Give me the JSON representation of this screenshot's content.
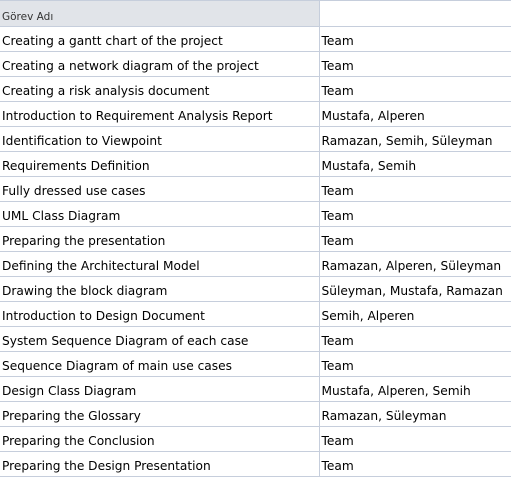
{
  "header": {
    "task_name": "Görev Adı",
    "resources": ""
  },
  "rows": [
    {
      "task": "Creating a gantt chart of the project",
      "resources": "Team"
    },
    {
      "task": "Creating a network diagram of the project",
      "resources": "Team"
    },
    {
      "task": "Creating a risk analysis document",
      "resources": "Team"
    },
    {
      "task": "Introduction to Requirement Analysis Report",
      "resources": "Mustafa, Alperen"
    },
    {
      "task": "Identification to Viewpoint",
      "resources": "Ramazan, Semih, Süleyman"
    },
    {
      "task": "Requirements Definition",
      "resources": "Mustafa, Semih"
    },
    {
      "task": "Fully dressed use cases",
      "resources": "Team"
    },
    {
      "task": "UML Class Diagram",
      "resources": "Team"
    },
    {
      "task": "Preparing the presentation",
      "resources": "Team"
    },
    {
      "task": "Defining the Architectural Model",
      "resources": "Ramazan, Alperen, Süleyman"
    },
    {
      "task": "Drawing the block diagram",
      "resources": "Süleyman, Mustafa, Ramazan"
    },
    {
      "task": "Introduction to Design Document",
      "resources": "Semih, Alperen"
    },
    {
      "task": "System Sequence Diagram of each case",
      "resources": "Team"
    },
    {
      "task": "Sequence Diagram of main use cases",
      "resources": "Team"
    },
    {
      "task": "Design Class Diagram",
      "resources": "Mustafa, Alperen, Semih"
    },
    {
      "task": "Preparing the Glossary",
      "resources": "Ramazan, Süleyman"
    },
    {
      "task": "Preparing the Conclusion",
      "resources": "Team"
    },
    {
      "task": "Preparing the Design Presentation",
      "resources": "Team"
    }
  ]
}
